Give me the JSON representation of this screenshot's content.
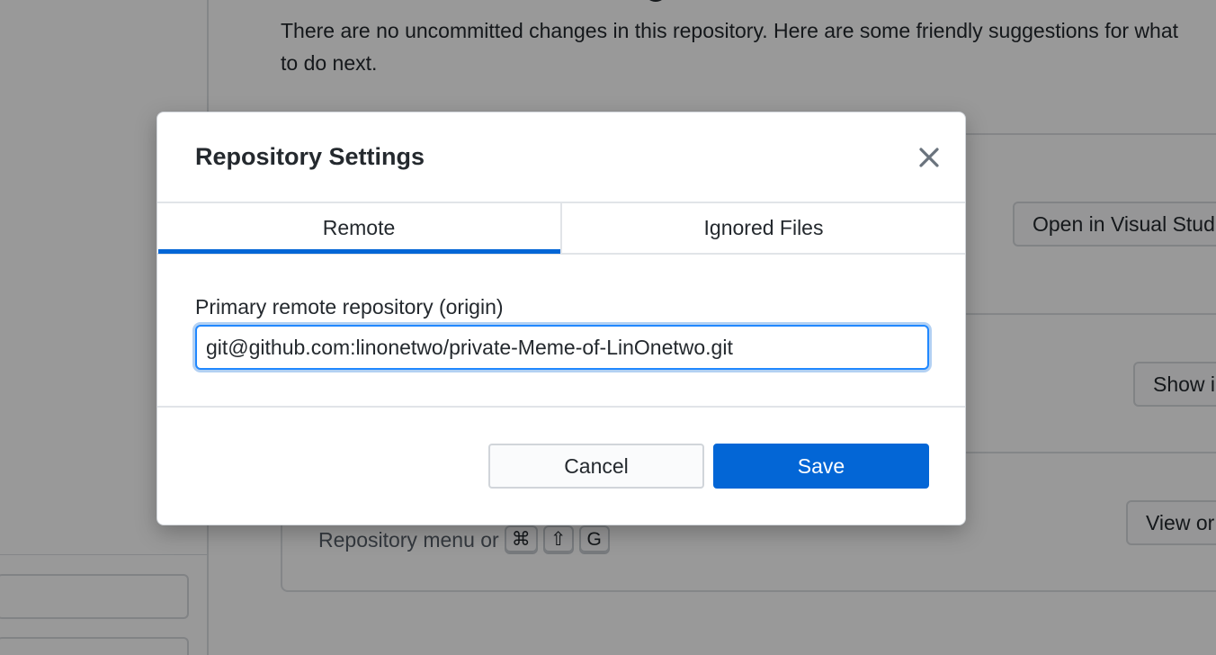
{
  "background": {
    "description_text": "There are no uncommitted changes in this repository. Here are some friendly suggestions for what to do next.",
    "suggestion_buttons": [
      "Open in Visual Stud",
      "Show i",
      "View or"
    ],
    "hint_text": "Repository menu or",
    "shortcut_keys": [
      "⌘",
      "⇧",
      "G"
    ]
  },
  "dialog": {
    "title": "Repository Settings",
    "close_icon": "close-icon",
    "tabs": [
      {
        "label": "Remote",
        "active": true
      },
      {
        "label": "Ignored Files",
        "active": false
      }
    ],
    "remote": {
      "label": "Primary remote repository (origin)",
      "value": "git@github.com:linonetwo/private-Meme-of-LinOnetwo.git"
    },
    "buttons": {
      "cancel": "Cancel",
      "save": "Save"
    }
  },
  "colors": {
    "accent": "#0366d6",
    "overlay": "rgba(0,0,0,0.4)"
  }
}
